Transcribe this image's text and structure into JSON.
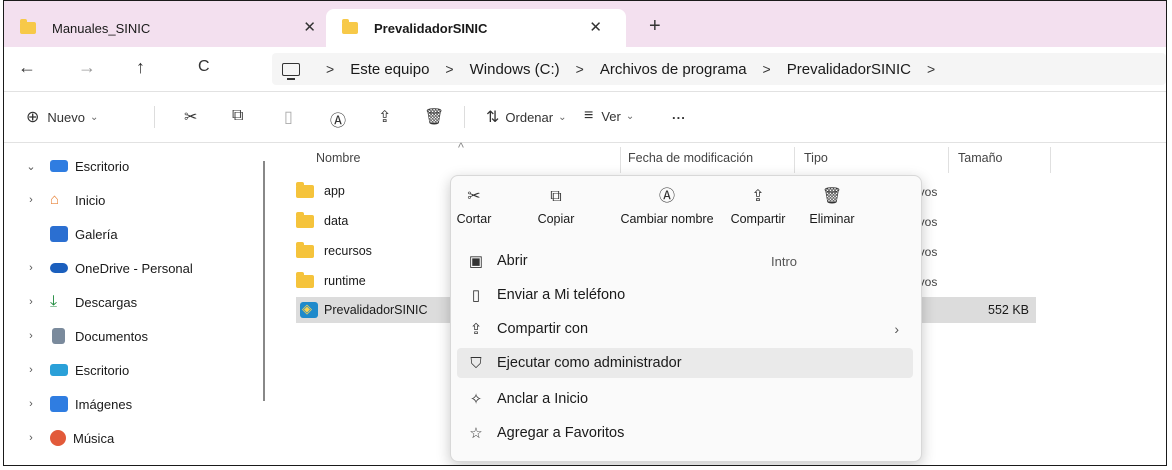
{
  "tabs": [
    {
      "title": "Manuales_SINIC",
      "active": false
    },
    {
      "title": "PrevalidadorSINIC",
      "active": true
    }
  ],
  "nav": {
    "back": "←",
    "forward": "→",
    "up": "↑",
    "refresh": "C"
  },
  "breadcrumb": [
    "Este equipo",
    "Windows (C:)",
    "Archivos de programa",
    "PrevalidadorSINIC"
  ],
  "toolbar": {
    "new_label": "Nuevo",
    "sort_label": "Ordenar",
    "view_label": "Ver",
    "more_label": "..."
  },
  "sidebar": {
    "items": [
      {
        "label": "Escritorio",
        "icon": "desktop-icon",
        "color": "#2f7de1"
      },
      {
        "label": "Inicio",
        "icon": "home-icon",
        "color": "#e8843a"
      },
      {
        "label": "Galería",
        "icon": "gallery-icon",
        "color": "#2b6fd1"
      },
      {
        "label": "OneDrive - Personal",
        "icon": "cloud-icon",
        "color": "#1b5fbd"
      },
      {
        "label": "Descargas",
        "icon": "download-icon",
        "color": "#1d8a3c"
      },
      {
        "label": "Documentos",
        "icon": "documents-icon",
        "color": "#7a8a9c"
      },
      {
        "label": "Escritorio",
        "icon": "desktop-icon",
        "color": "#2aa0d8"
      },
      {
        "label": "Imágenes",
        "icon": "pictures-icon",
        "color": "#2f7de1"
      },
      {
        "label": "Música",
        "icon": "music-icon",
        "color": "#e25a3a"
      }
    ]
  },
  "columns": {
    "name": "Nombre",
    "modified": "Fecha de modificación",
    "type": "Tipo",
    "size": "Tamaño"
  },
  "files": [
    {
      "name": "app",
      "type_fragment": "ivos"
    },
    {
      "name": "data",
      "type_fragment": "ivos"
    },
    {
      "name": "recursos",
      "type_fragment": "ivos"
    },
    {
      "name": "runtime",
      "type_fragment": "ivos"
    },
    {
      "name": "PrevalidadorSINIC",
      "size": "552 KB"
    }
  ],
  "context_menu": {
    "quick_actions": [
      {
        "label": "Cortar",
        "icon": "scissors-icon"
      },
      {
        "label": "Copiar",
        "icon": "copy-icon"
      },
      {
        "label": "Cambiar nombre",
        "icon": "rename-icon"
      },
      {
        "label": "Compartir",
        "icon": "share-icon"
      },
      {
        "label": "Eliminar",
        "icon": "trash-icon"
      }
    ],
    "items": [
      {
        "label": "Abrir",
        "accelerator": "Intro",
        "icon": "open-icon"
      },
      {
        "label": "Enviar a Mi teléfono",
        "icon": "phone-icon"
      },
      {
        "label": "Compartir con",
        "icon": "share-icon"
      },
      {
        "label": "Ejecutar como administrador",
        "icon": "shield-icon"
      },
      {
        "label": "Anclar a Inicio",
        "icon": "pin-icon"
      },
      {
        "label": "Agregar a Favoritos",
        "icon": "star-icon"
      }
    ]
  }
}
